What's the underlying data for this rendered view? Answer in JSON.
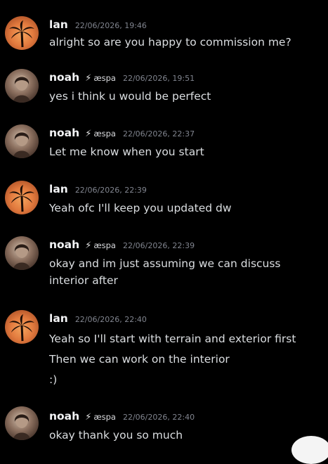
{
  "messages": [
    {
      "author": "lan",
      "tag": "",
      "time": "22/06/2026, 19:46",
      "lines": [
        "alright so are you happy to commission me?"
      ]
    },
    {
      "author": "noah",
      "tag": "æspa",
      "time": "22/06/2026, 19:51",
      "lines": [
        "yes i think u would be perfect"
      ]
    },
    {
      "author": "noah",
      "tag": "æspa",
      "time": "22/06/2026, 22:37",
      "lines": [
        "Let me know when you start"
      ]
    },
    {
      "author": "lan",
      "tag": "",
      "time": "22/06/2026, 22:39",
      "lines": [
        "Yeah ofc I'll keep you updated dw"
      ]
    },
    {
      "author": "noah",
      "tag": "æspa",
      "time": "22/06/2026, 22:39",
      "lines": [
        "okay and im just assuming we can discuss",
        "interior after"
      ]
    },
    {
      "author": "lan",
      "tag": "",
      "time": "22/06/2026, 22:40",
      "lines": [
        "Yeah so I'll start with terrain and exterior first",
        "Then we can work on the interior",
        ":)"
      ]
    },
    {
      "author": "noah",
      "tag": "æspa",
      "time": "22/06/2026, 22:40",
      "lines": [
        "okay thank you so much"
      ]
    }
  ],
  "icons": {
    "tag_icon": "lightning-bolt-icon",
    "lan_avatar": "palm-tree-sunset-avatar",
    "noah_avatar": "photo-avatar"
  },
  "colors": {
    "background": "#000000",
    "username": "#f2f3f5",
    "message": "#dbdee1",
    "timestamp": "#80848e"
  }
}
